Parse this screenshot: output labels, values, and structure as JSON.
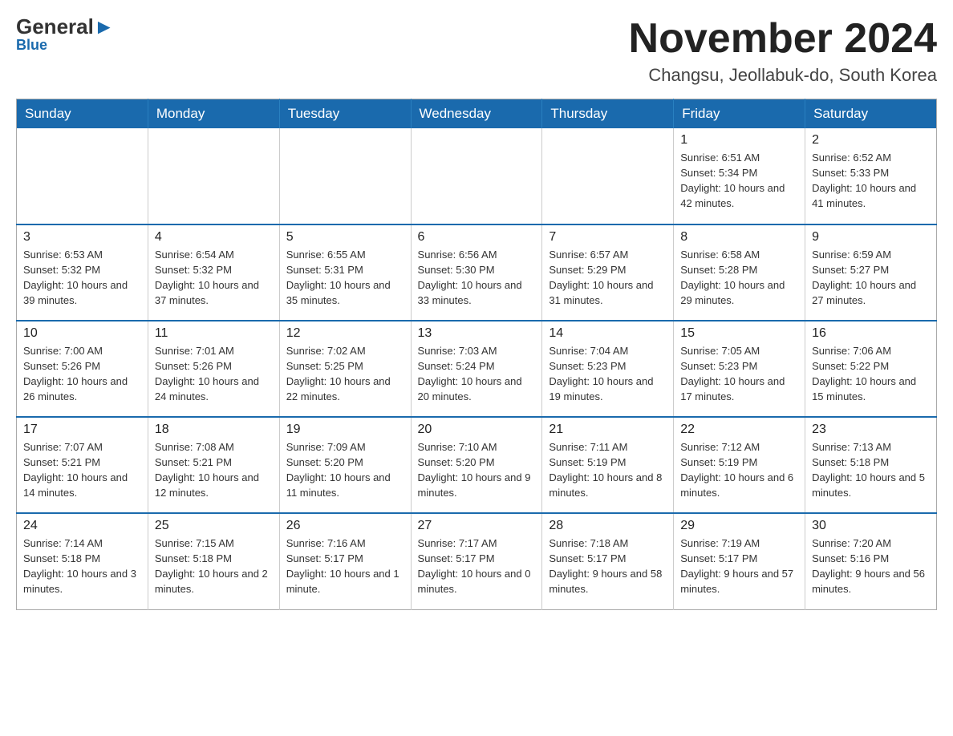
{
  "logo": {
    "general": "General",
    "triangle": "▲",
    "blue": "Blue"
  },
  "title": {
    "month": "November 2024",
    "location": "Changsu, Jeollabuk-do, South Korea"
  },
  "weekdays": [
    "Sunday",
    "Monday",
    "Tuesday",
    "Wednesday",
    "Thursday",
    "Friday",
    "Saturday"
  ],
  "weeks": [
    {
      "days": [
        {
          "num": "",
          "info": ""
        },
        {
          "num": "",
          "info": ""
        },
        {
          "num": "",
          "info": ""
        },
        {
          "num": "",
          "info": ""
        },
        {
          "num": "",
          "info": ""
        },
        {
          "num": "1",
          "info": "Sunrise: 6:51 AM\nSunset: 5:34 PM\nDaylight: 10 hours and 42 minutes."
        },
        {
          "num": "2",
          "info": "Sunrise: 6:52 AM\nSunset: 5:33 PM\nDaylight: 10 hours and 41 minutes."
        }
      ]
    },
    {
      "days": [
        {
          "num": "3",
          "info": "Sunrise: 6:53 AM\nSunset: 5:32 PM\nDaylight: 10 hours and 39 minutes."
        },
        {
          "num": "4",
          "info": "Sunrise: 6:54 AM\nSunset: 5:32 PM\nDaylight: 10 hours and 37 minutes."
        },
        {
          "num": "5",
          "info": "Sunrise: 6:55 AM\nSunset: 5:31 PM\nDaylight: 10 hours and 35 minutes."
        },
        {
          "num": "6",
          "info": "Sunrise: 6:56 AM\nSunset: 5:30 PM\nDaylight: 10 hours and 33 minutes."
        },
        {
          "num": "7",
          "info": "Sunrise: 6:57 AM\nSunset: 5:29 PM\nDaylight: 10 hours and 31 minutes."
        },
        {
          "num": "8",
          "info": "Sunrise: 6:58 AM\nSunset: 5:28 PM\nDaylight: 10 hours and 29 minutes."
        },
        {
          "num": "9",
          "info": "Sunrise: 6:59 AM\nSunset: 5:27 PM\nDaylight: 10 hours and 27 minutes."
        }
      ]
    },
    {
      "days": [
        {
          "num": "10",
          "info": "Sunrise: 7:00 AM\nSunset: 5:26 PM\nDaylight: 10 hours and 26 minutes."
        },
        {
          "num": "11",
          "info": "Sunrise: 7:01 AM\nSunset: 5:26 PM\nDaylight: 10 hours and 24 minutes."
        },
        {
          "num": "12",
          "info": "Sunrise: 7:02 AM\nSunset: 5:25 PM\nDaylight: 10 hours and 22 minutes."
        },
        {
          "num": "13",
          "info": "Sunrise: 7:03 AM\nSunset: 5:24 PM\nDaylight: 10 hours and 20 minutes."
        },
        {
          "num": "14",
          "info": "Sunrise: 7:04 AM\nSunset: 5:23 PM\nDaylight: 10 hours and 19 minutes."
        },
        {
          "num": "15",
          "info": "Sunrise: 7:05 AM\nSunset: 5:23 PM\nDaylight: 10 hours and 17 minutes."
        },
        {
          "num": "16",
          "info": "Sunrise: 7:06 AM\nSunset: 5:22 PM\nDaylight: 10 hours and 15 minutes."
        }
      ]
    },
    {
      "days": [
        {
          "num": "17",
          "info": "Sunrise: 7:07 AM\nSunset: 5:21 PM\nDaylight: 10 hours and 14 minutes."
        },
        {
          "num": "18",
          "info": "Sunrise: 7:08 AM\nSunset: 5:21 PM\nDaylight: 10 hours and 12 minutes."
        },
        {
          "num": "19",
          "info": "Sunrise: 7:09 AM\nSunset: 5:20 PM\nDaylight: 10 hours and 11 minutes."
        },
        {
          "num": "20",
          "info": "Sunrise: 7:10 AM\nSunset: 5:20 PM\nDaylight: 10 hours and 9 minutes."
        },
        {
          "num": "21",
          "info": "Sunrise: 7:11 AM\nSunset: 5:19 PM\nDaylight: 10 hours and 8 minutes."
        },
        {
          "num": "22",
          "info": "Sunrise: 7:12 AM\nSunset: 5:19 PM\nDaylight: 10 hours and 6 minutes."
        },
        {
          "num": "23",
          "info": "Sunrise: 7:13 AM\nSunset: 5:18 PM\nDaylight: 10 hours and 5 minutes."
        }
      ]
    },
    {
      "days": [
        {
          "num": "24",
          "info": "Sunrise: 7:14 AM\nSunset: 5:18 PM\nDaylight: 10 hours and 3 minutes."
        },
        {
          "num": "25",
          "info": "Sunrise: 7:15 AM\nSunset: 5:18 PM\nDaylight: 10 hours and 2 minutes."
        },
        {
          "num": "26",
          "info": "Sunrise: 7:16 AM\nSunset: 5:17 PM\nDaylight: 10 hours and 1 minute."
        },
        {
          "num": "27",
          "info": "Sunrise: 7:17 AM\nSunset: 5:17 PM\nDaylight: 10 hours and 0 minutes."
        },
        {
          "num": "28",
          "info": "Sunrise: 7:18 AM\nSunset: 5:17 PM\nDaylight: 9 hours and 58 minutes."
        },
        {
          "num": "29",
          "info": "Sunrise: 7:19 AM\nSunset: 5:17 PM\nDaylight: 9 hours and 57 minutes."
        },
        {
          "num": "30",
          "info": "Sunrise: 7:20 AM\nSunset: 5:16 PM\nDaylight: 9 hours and 56 minutes."
        }
      ]
    }
  ]
}
